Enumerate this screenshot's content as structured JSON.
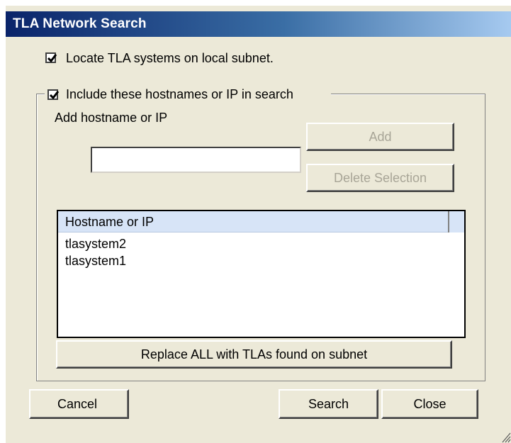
{
  "window": {
    "title": "TLA Network Search"
  },
  "options": {
    "locate_local_label": "Locate TLA systems on local subnet.",
    "locate_local_checked": true,
    "include_hosts_label": "Include these hostnames or IP in search",
    "include_hosts_checked": true
  },
  "hostname_entry": {
    "label": "Add hostname or IP",
    "value": "",
    "placeholder": ""
  },
  "buttons": {
    "add": "Add",
    "delete_selection": "Delete Selection",
    "replace_all": "Replace ALL with TLAs found on subnet",
    "cancel": "Cancel",
    "search": "Search",
    "close": "Close"
  },
  "host_list": {
    "column_header": "Hostname or IP",
    "rows": [
      "tlasystem2",
      "tlasystem1"
    ]
  },
  "icons": {
    "checkbox_check": "check-icon",
    "resize_grip": "resize-grip-icon"
  },
  "colors": {
    "titlebar_start": "#0a246a",
    "titlebar_end": "#a6caf0",
    "dialog_bg": "#ece9d8",
    "disabled_text": "#a8a597"
  }
}
